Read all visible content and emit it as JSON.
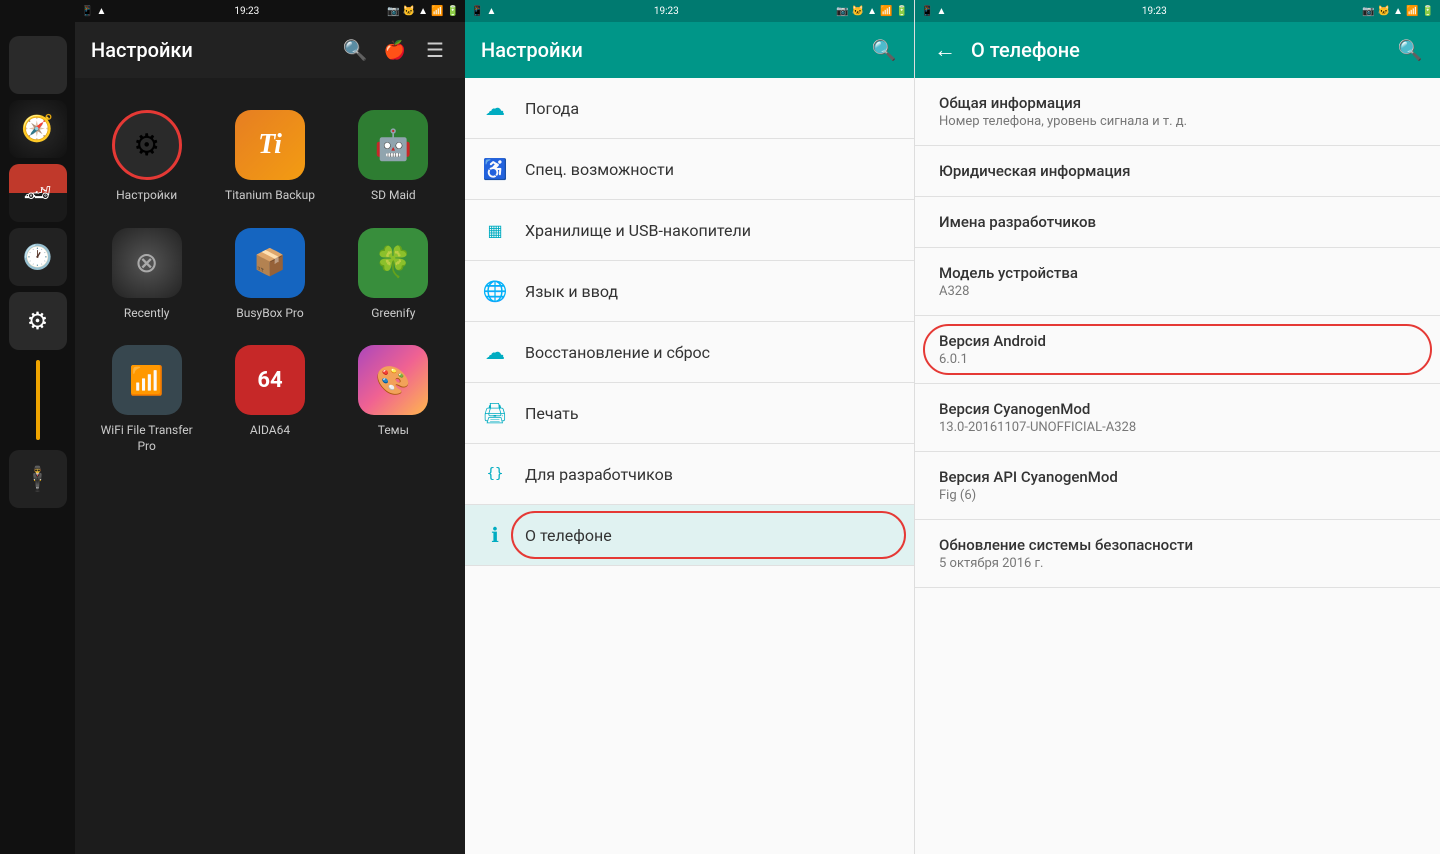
{
  "statusBar": {
    "time": "19:23",
    "icons": "◼ ▲ ▲ 📶 🔋"
  },
  "leftPanel": {
    "title": "Настройки",
    "apps": [
      {
        "id": "nastroyki",
        "label": "Настройки",
        "icon": "⚙",
        "bgColor": "#2a2a2a",
        "selected": true
      },
      {
        "id": "titanium",
        "label": "Titanium Backup",
        "icon": "Ti",
        "bgColor": "#e67e22"
      },
      {
        "id": "sdmaid",
        "label": "SD Maid",
        "icon": "🤖",
        "bgColor": "#2e7d32"
      },
      {
        "id": "recently",
        "label": "Recently",
        "icon": "⊘",
        "bgColor": "#333"
      },
      {
        "id": "busybox",
        "label": "BusyBox Pro",
        "icon": "📦",
        "bgColor": "#1565c0"
      },
      {
        "id": "greenify",
        "label": "Greenify",
        "icon": "🍀",
        "bgColor": "#388e3c"
      },
      {
        "id": "wifi",
        "label": "WiFi File Transfer Pro",
        "icon": "📶",
        "bgColor": "#37474f"
      },
      {
        "id": "aida64",
        "label": "AIDA64",
        "icon": "64",
        "bgColor": "#c62828"
      },
      {
        "id": "themes",
        "label": "Темы",
        "icon": "🎨",
        "bgColor": "#ab47bc"
      }
    ]
  },
  "middlePanel": {
    "title": "Настройки",
    "searchIcon": "🔍",
    "appleIcon": "🍎",
    "menuIcon": "☰",
    "items": [
      {
        "id": "weather",
        "icon": "☁",
        "label": "Погода",
        "iconColor": "#00acc1"
      },
      {
        "id": "accessibility",
        "icon": "♿",
        "label": "Спец. возможности",
        "iconColor": "#00acc1"
      },
      {
        "id": "storage",
        "icon": "▦",
        "label": "Хранилище и USB-накопители",
        "iconColor": "#00acc1"
      },
      {
        "id": "language",
        "icon": "🌐",
        "label": "Язык и ввод",
        "iconColor": "#00acc1"
      },
      {
        "id": "backup",
        "icon": "☁",
        "label": "Восстановление и сброс",
        "iconColor": "#00acc1"
      },
      {
        "id": "print",
        "icon": "🖨",
        "label": "Печать",
        "iconColor": "#00acc1"
      },
      {
        "id": "developer",
        "icon": "{}",
        "label": "Для разработчиков",
        "iconColor": "#00acc1"
      },
      {
        "id": "about",
        "icon": "ℹ",
        "label": "О телефоне",
        "iconColor": "#00acc1",
        "active": true
      }
    ]
  },
  "rightPanel": {
    "title": "О телефоне",
    "backIcon": "←",
    "searchIcon": "🔍",
    "items": [
      {
        "id": "general",
        "title": "Общая информация",
        "subtitle": "Номер телефона, уровень сигнала и т. д."
      },
      {
        "id": "legal",
        "title": "Юридическая информация",
        "subtitle": ""
      },
      {
        "id": "devnames",
        "title": "Имена разработчиков",
        "subtitle": ""
      },
      {
        "id": "model",
        "title": "Модель устройства",
        "subtitle": "A328"
      },
      {
        "id": "android",
        "title": "Версия Android",
        "subtitle": "6.0.1",
        "highlighted": true
      },
      {
        "id": "cyanogen",
        "title": "Версия CyanogenMod",
        "subtitle": "13.0-20161107-UNOFFICIAL-A328"
      },
      {
        "id": "api",
        "title": "Версия API CyanogenMod",
        "subtitle": "Fig (6)"
      },
      {
        "id": "security",
        "title": "Обновление системы безопасности",
        "subtitle": "5 октября 2016 г."
      }
    ]
  }
}
